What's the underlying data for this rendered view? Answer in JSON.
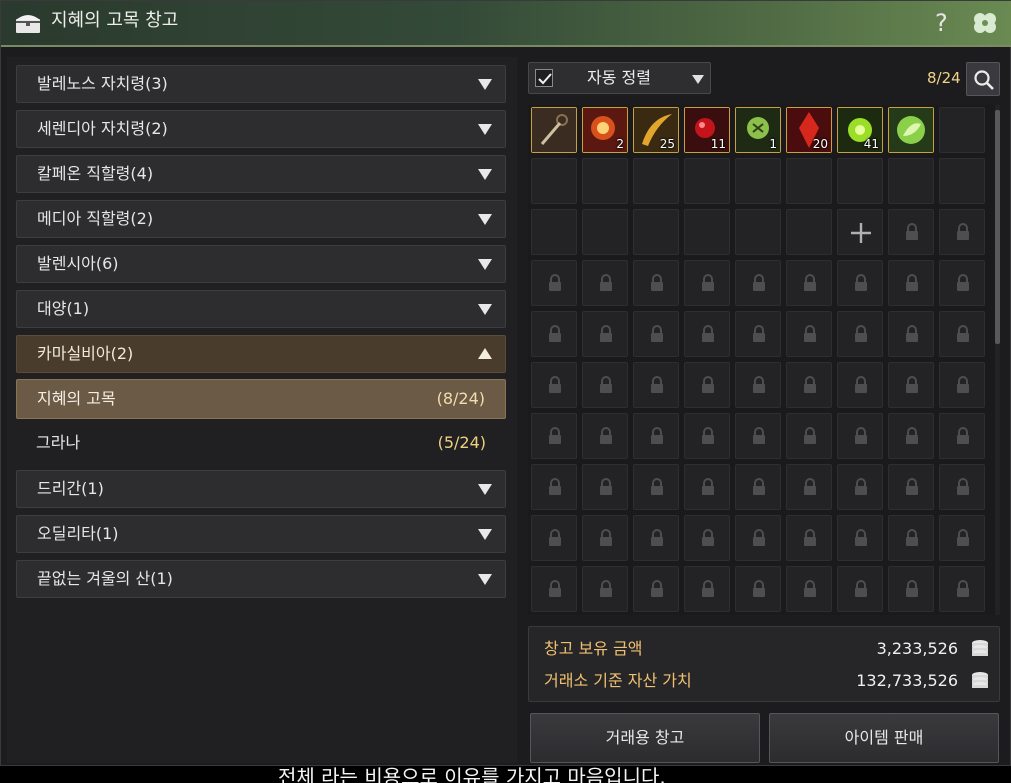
{
  "window": {
    "title": "지혜의 고목 창고",
    "help_label": "?",
    "title_icon": "chest-icon",
    "clover_icon": "clover-icon"
  },
  "regions": [
    {
      "label": "발레노스 자치령(3)",
      "state": "collapsed"
    },
    {
      "label": "세렌디아 자치령(2)",
      "state": "collapsed"
    },
    {
      "label": "칼페온 직할령(4)",
      "state": "collapsed"
    },
    {
      "label": "메디아 직할령(2)",
      "state": "collapsed"
    },
    {
      "label": "발렌시아(6)",
      "state": "collapsed"
    },
    {
      "label": "대양(1)",
      "state": "collapsed"
    },
    {
      "label": "카마실비아(2)",
      "state": "expanded"
    },
    {
      "label": "드리간(1)",
      "state": "collapsed"
    },
    {
      "label": "오딜리타(1)",
      "state": "collapsed"
    },
    {
      "label": "끝없는 겨울의 산(1)",
      "state": "collapsed"
    }
  ],
  "sub_items": [
    {
      "label": "지혜의 고목",
      "count": "(8/24)",
      "selected": true
    },
    {
      "label": "그라나",
      "count": "(5/24)",
      "selected": false
    }
  ],
  "storage": {
    "auto_sort_checked": true,
    "auto_sort_label": "자동 정렬",
    "capacity": "8/24",
    "items": [
      {
        "icon": "rope-hook-icon",
        "qty": ""
      },
      {
        "icon": "red-burst-stone-icon",
        "qty": "2"
      },
      {
        "icon": "golden-horn-icon",
        "qty": "25"
      },
      {
        "icon": "red-orb-icon",
        "qty": "11"
      },
      {
        "icon": "green-rune-icon",
        "qty": "1"
      },
      {
        "icon": "red-crystal-icon",
        "qty": "20"
      },
      {
        "icon": "green-spark-icon",
        "qty": "41"
      },
      {
        "icon": "green-leaf-orb-icon",
        "qty": ""
      }
    ],
    "empty_slots": 16,
    "expand_slot_count": 1,
    "locked_slots": 65
  },
  "silver": {
    "storage_label": "창고 보유 금액",
    "storage_value": "3,233,526",
    "market_label": "거래소 기준 자산 가치",
    "market_value": "132,733,526",
    "coin_icon": "silver-coin-stack-icon"
  },
  "buttons": {
    "trade_storage": "거래용 창고",
    "sell_items": "아이템 판매"
  },
  "subtitle": "전체 라는 비용으로 이유를 가지고 마음입니다."
}
